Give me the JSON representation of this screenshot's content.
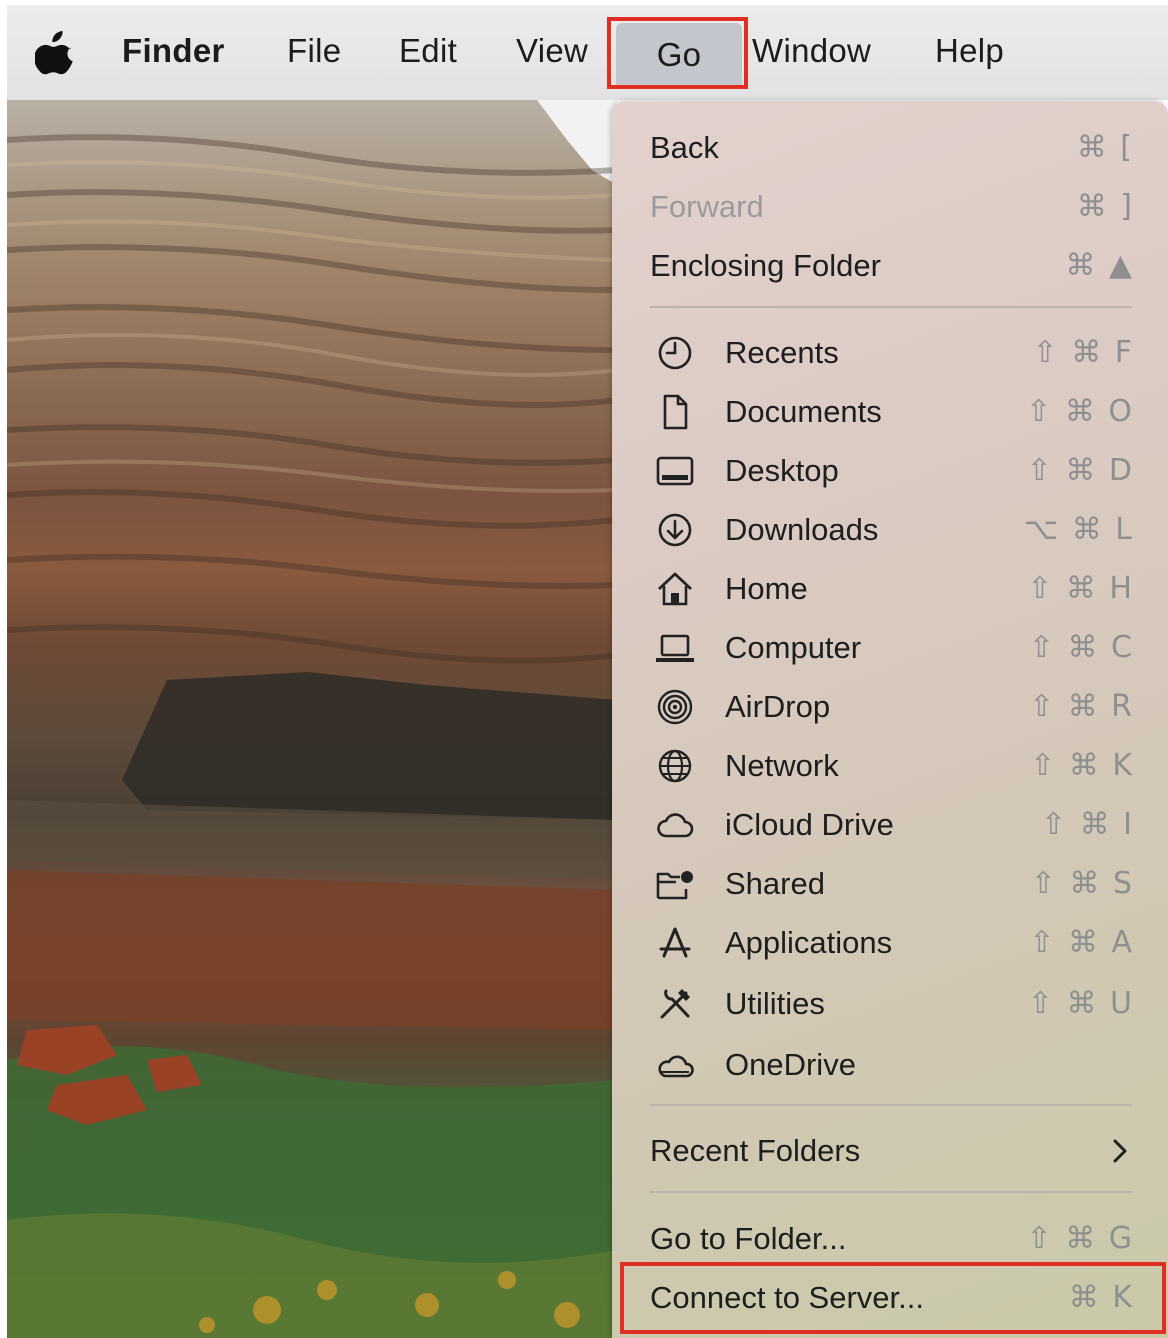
{
  "menubar": {
    "app_name": "Finder",
    "items": [
      "File",
      "Edit",
      "View",
      "Go",
      "Window",
      "Help"
    ],
    "active_item": "Go"
  },
  "go_menu": {
    "nav": [
      {
        "label": "Back",
        "shortcut": "⌘ [",
        "enabled": true
      },
      {
        "label": "Forward",
        "shortcut": "⌘ ]",
        "enabled": false
      },
      {
        "label": "Enclosing Folder",
        "shortcut": "⌘ ▲",
        "enabled": true
      }
    ],
    "places": [
      {
        "label": "Recents",
        "shortcut": "⇧ ⌘ F",
        "icon": "clock-icon"
      },
      {
        "label": "Documents",
        "shortcut": "⇧ ⌘ O",
        "icon": "document-icon"
      },
      {
        "label": "Desktop",
        "shortcut": "⇧ ⌘ D",
        "icon": "desktop-icon"
      },
      {
        "label": "Downloads",
        "shortcut": "⌥ ⌘ L",
        "icon": "download-icon"
      },
      {
        "label": "Home",
        "shortcut": "⇧ ⌘ H",
        "icon": "home-icon"
      },
      {
        "label": "Computer",
        "shortcut": "⇧ ⌘ C",
        "icon": "laptop-icon"
      },
      {
        "label": "AirDrop",
        "shortcut": "⇧ ⌘ R",
        "icon": "airdrop-icon"
      },
      {
        "label": "Network",
        "shortcut": "⇧ ⌘ K",
        "icon": "globe-icon"
      },
      {
        "label": "iCloud Drive",
        "shortcut": "⇧ ⌘ I",
        "icon": "cloud-icon"
      },
      {
        "label": "Shared",
        "shortcut": "⇧ ⌘ S",
        "icon": "shared-folder-icon"
      },
      {
        "label": "Applications",
        "shortcut": "⇧ ⌘ A",
        "icon": "applications-icon"
      },
      {
        "label": "Utilities",
        "shortcut": "⇧ ⌘ U",
        "icon": "tools-icon"
      },
      {
        "label": "OneDrive",
        "shortcut": "",
        "icon": "onedrive-cloud-icon"
      }
    ],
    "recent_folders": {
      "label": "Recent Folders",
      "icon": "chevron-right-icon"
    },
    "go_to_folder": {
      "label": "Go to Folder...",
      "shortcut": "⇧ ⌘ G"
    },
    "connect_to_server": {
      "label": "Connect to Server...",
      "shortcut": "⌘ K"
    }
  },
  "colors": {
    "highlight_box": "#e12e22",
    "menu_active_bg": "#c3c6cc"
  }
}
